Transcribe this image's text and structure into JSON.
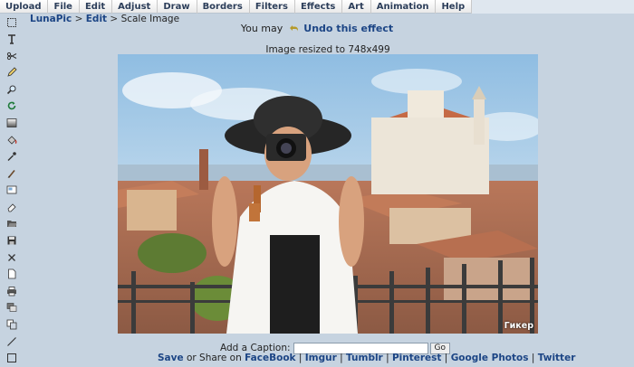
{
  "menu": {
    "items": [
      "Upload",
      "File",
      "Edit",
      "Adjust",
      "Draw",
      "Borders",
      "Filters",
      "Effects",
      "Art",
      "Animation",
      "Help"
    ]
  },
  "toolbar": {
    "icons": [
      "select-icon",
      "text-icon",
      "scissors-icon",
      "pencil-icon",
      "magnifier-icon",
      "rotate-icon",
      "gradient-icon",
      "fill-bucket-icon",
      "eyedropper-icon",
      "brush-icon",
      "crop-icon",
      "eraser-icon",
      "open-folder-icon",
      "save-icon",
      "close-icon",
      "new-document-icon",
      "print-icon",
      "layers-icon",
      "copy-icon",
      "line-icon",
      "rectangle-icon"
    ]
  },
  "breadcrumb": {
    "home": "LunaPic",
    "sep1": ">",
    "section": "Edit",
    "sep2": ">",
    "current": "Scale Image"
  },
  "undo": {
    "prefix": "You may",
    "link": "Undo this effect"
  },
  "status": {
    "message": "Image resized to 748x499"
  },
  "image": {
    "watermark": "Гикер"
  },
  "caption": {
    "label": "Add a Caption:",
    "value": "",
    "button": "Go"
  },
  "share": {
    "save": "Save",
    "or_share": "or Share on",
    "facebook": "FaceBook",
    "imgur": "Imgur",
    "tumblr": "Tumblr",
    "pinterest": "Pinterest",
    "google_photos": "Google Photos",
    "twitter": "Twitter",
    "divider": "|"
  },
  "colors": {
    "background": "#c6d3e0",
    "link": "#1c4585"
  }
}
